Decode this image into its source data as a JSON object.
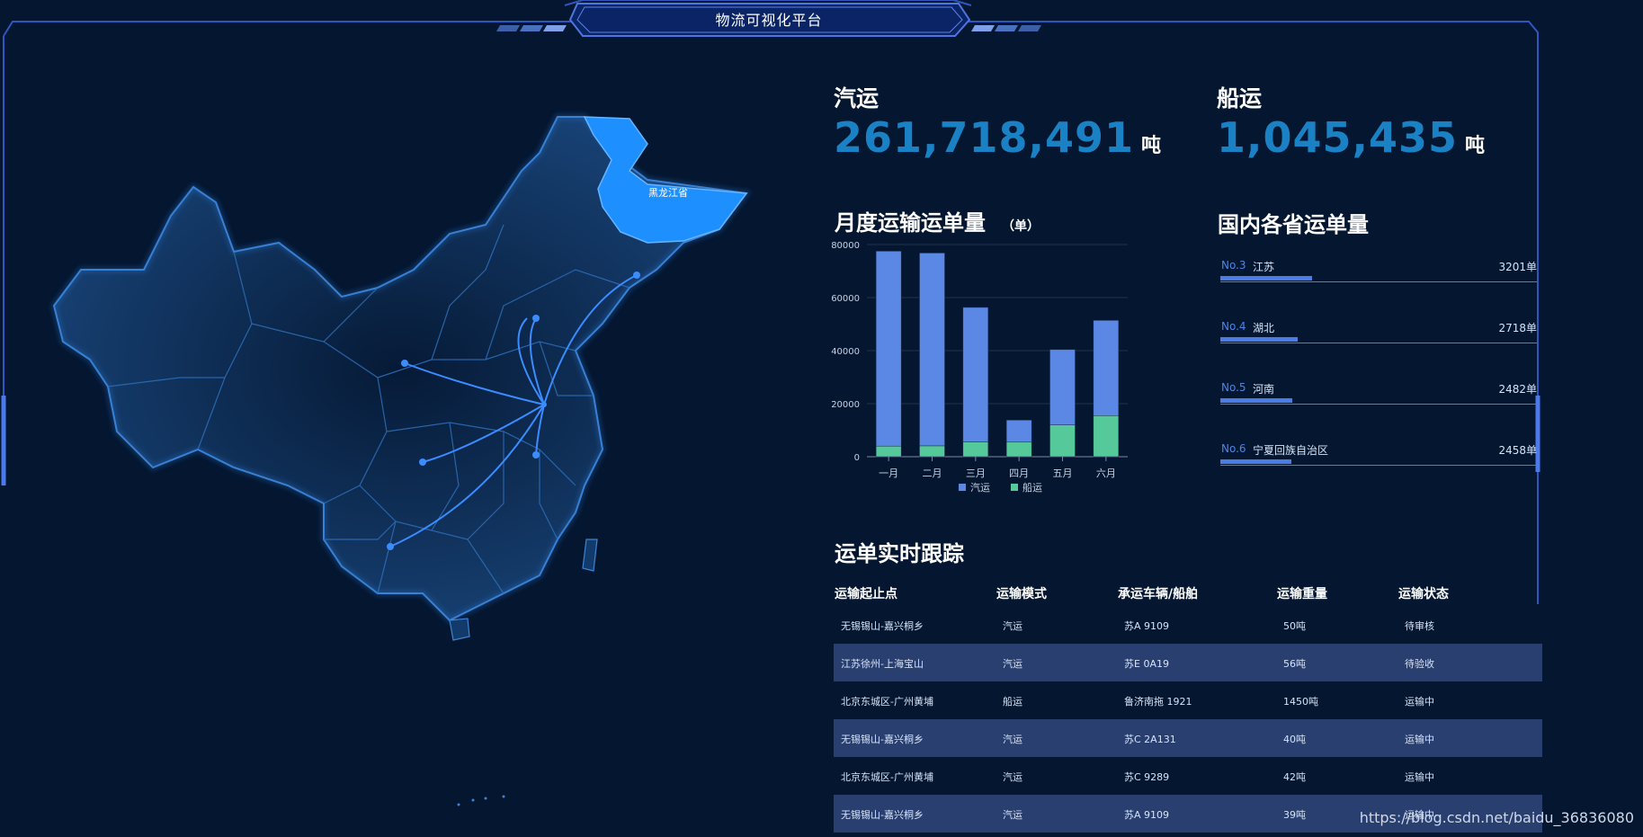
{
  "header": {
    "title": "物流可视化平台"
  },
  "map": {
    "highlight_label": "黑龙江省"
  },
  "stats": [
    {
      "label": "汽运",
      "value": "261,718,491",
      "unit": "吨"
    },
    {
      "label": "船运",
      "value": "1,045,435",
      "unit": "吨"
    }
  ],
  "monthly": {
    "title": "月度运输运单量",
    "unit": "（单）"
  },
  "chart_data": {
    "type": "bar",
    "stacked": true,
    "categories": [
      "一月",
      "二月",
      "三月",
      "四月",
      "五月",
      "六月"
    ],
    "series": [
      {
        "name": "汽运",
        "color": "#5b87e5",
        "values": [
          73500,
          72700,
          50700,
          8300,
          28400,
          35900
        ]
      },
      {
        "name": "船运",
        "color": "#55c99a",
        "values": [
          4000,
          4100,
          5600,
          5500,
          12000,
          15500
        ]
      }
    ],
    "ylim": [
      0,
      80000
    ],
    "yticks": [
      "0",
      "20000",
      "40000",
      "60000",
      "80000"
    ],
    "legend": "bottom",
    "grid": true
  },
  "provinces": {
    "title": "国内各省运单量",
    "items": [
      {
        "no": "No.3",
        "name": "江苏",
        "value": "3201单",
        "ratio": 0.29
      },
      {
        "no": "No.4",
        "name": "湖北",
        "value": "2718单",
        "ratio": 0.245
      },
      {
        "no": "No.5",
        "name": "河南",
        "value": "2482单",
        "ratio": 0.226
      },
      {
        "no": "No.6",
        "name": "宁夏回族自治区",
        "value": "2458单",
        "ratio": 0.224
      }
    ]
  },
  "tracking": {
    "title": "运单实时跟踪",
    "columns": [
      "运输起止点",
      "运输模式",
      "承运车辆/船舶",
      "运输重量",
      "运输状态"
    ],
    "rows": [
      [
        "无锡锡山-嘉兴桐乡",
        "汽运",
        "苏A 9109",
        "50吨",
        "待审核"
      ],
      [
        "江苏徐州-上海宝山",
        "汽运",
        "苏E 0A19",
        "56吨",
        "待验收"
      ],
      [
        "北京东城区-广州黄埔",
        "船运",
        "鲁济南拖 1921",
        "1450吨",
        "运输中"
      ],
      [
        "无锡锡山-嘉兴桐乡",
        "汽运",
        "苏C 2A131",
        "40吨",
        "运输中"
      ],
      [
        "北京东城区-广州黄埔",
        "汽运",
        "苏C 9289",
        "42吨",
        "运输中"
      ],
      [
        "无锡锡山-嘉兴桐乡",
        "汽运",
        "苏A 9109",
        "39吨",
        "运输中"
      ]
    ]
  },
  "watermark": "https://blog.csdn.net/baidu_36836080",
  "colors": {
    "background": "#041630",
    "accent": "#1a82c4",
    "frame": "#3a5fc8",
    "bar_blue": "#5b87e5",
    "bar_green": "#55c99a"
  }
}
